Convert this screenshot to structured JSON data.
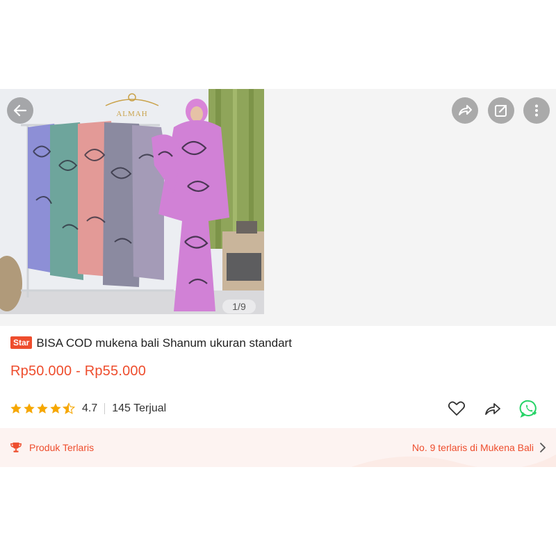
{
  "gallery": {
    "brand_watermark": "ALMAH",
    "image_index": "1/9"
  },
  "product": {
    "badge": "Star",
    "title": "BISA COD mukena bali Shanum ukuran standart",
    "price": "Rp50.000 - Rp55.000",
    "rating": "4.7",
    "rating_stars": 4.5,
    "sold": "145 Terjual"
  },
  "bestseller": {
    "label": "Produk Terlaris",
    "rank_text": "No. 9 terlaris di Mukena Bali"
  },
  "icons": {
    "back": "arrow-left-icon",
    "share": "share-icon",
    "edit": "edit-icon",
    "more": "more-vertical-icon",
    "like": "heart-icon",
    "share_small": "share-icon",
    "whatsapp": "whatsapp-icon",
    "trophy": "trophy-icon",
    "chevron": "chevron-right-icon"
  },
  "colors": {
    "accent": "#ee4d2d",
    "star": "#f6a700",
    "whatsapp": "#25d366",
    "bestseller_bg": "#fdf3f1"
  }
}
